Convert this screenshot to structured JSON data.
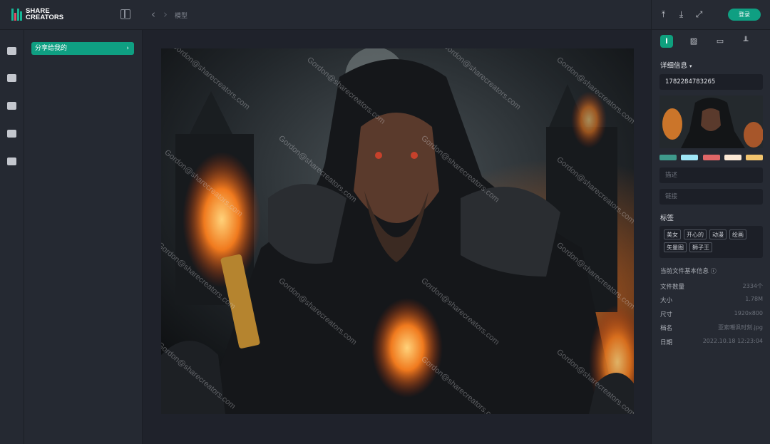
{
  "header": {
    "logo_line1": "SHARE",
    "logo_line2": "CREATORS",
    "breadcrumb": "模型"
  },
  "sidebar": {
    "active_item": "分享给我的"
  },
  "artwork": {
    "watermark": "Gordon@sharecreators.com"
  },
  "panel": {
    "login_label": "登录",
    "detail_title": "详细信息",
    "id_value": "1782284783265",
    "palette": [
      "#3f9a8c",
      "#9fe6f7",
      "#e06767",
      "#fce9d5",
      "#f2c46e"
    ],
    "description_placeholder": "描述",
    "link_placeholder": "链接",
    "tags_title": "标签",
    "tags": [
      "美女",
      "开心的",
      "动漫",
      "绘画",
      "矢量图",
      "狮子王"
    ],
    "file_info_title": "当前文件基本信息",
    "file_info": [
      {
        "label": "文件数量",
        "value": "2334个"
      },
      {
        "label": "大小",
        "value": "1.78M"
      },
      {
        "label": "尺寸",
        "value": "1920x800"
      },
      {
        "label": "档名",
        "value": "亚索嘲讽时刻.jpg"
      },
      {
        "label": "日期",
        "value": "2022.10.18 12:23:04"
      }
    ]
  }
}
